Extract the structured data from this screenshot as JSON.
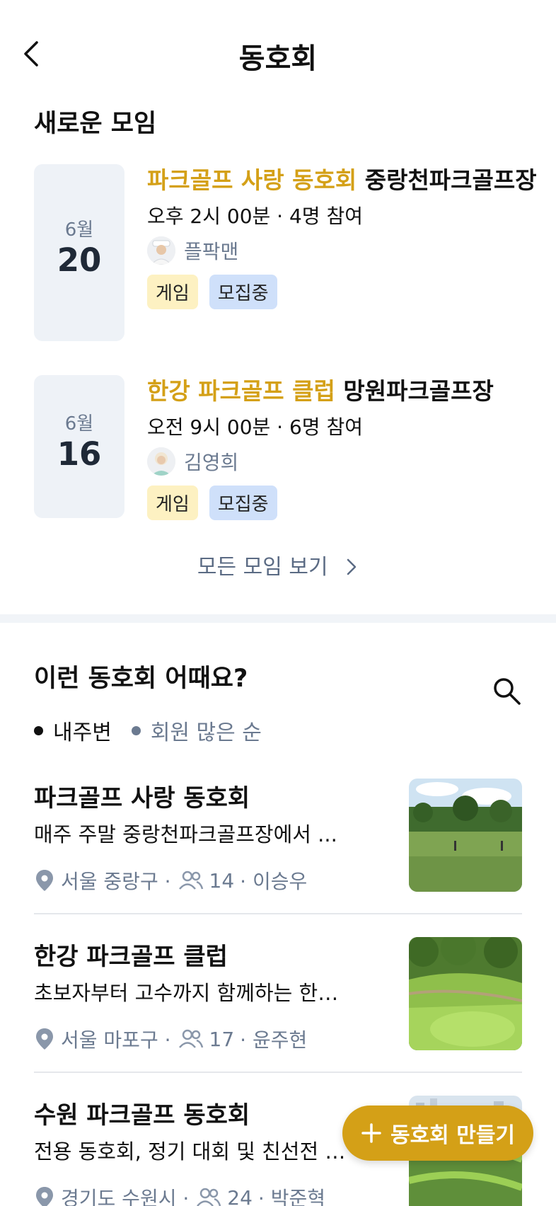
{
  "header": {
    "title": "동호회",
    "back_icon": "chevron-left-icon"
  },
  "new_meetings": {
    "title": "새로운 모임",
    "items": [
      {
        "month": "6월",
        "day": "20",
        "club": "파크골프 사랑 동호회",
        "place": "중랑천파크골프장",
        "time": "오후 2시 00분 · 4명 참여",
        "host": "플팍맨",
        "tags": [
          "게임",
          "모집중"
        ]
      },
      {
        "month": "6월",
        "day": "16",
        "club": "한강 파크골프 클럽",
        "place": "망원파크골프장",
        "time": "오전 9시 00분 · 6명 참여",
        "host": "김영희",
        "tags": [
          "게임",
          "모집중"
        ]
      }
    ],
    "see_all": "모든 모임 보기"
  },
  "recommend": {
    "title": "이런 동호회 어때요?",
    "search_icon": "search-icon",
    "filters": [
      "내주변",
      "회원 많은 순"
    ],
    "clubs": [
      {
        "name": "파크골프 사랑 동호회",
        "desc": "매주 주말 중랑천파크골프장에서 ...",
        "region": "서울 중랑구 ·",
        "members": "14",
        "leader": "· 이승우"
      },
      {
        "name": "한강 파크골프 클럽",
        "desc": "초보자부터 고수까지 함께하는 한강 ...",
        "region": "서울 마포구 ·",
        "members": "17",
        "leader": "· 윤주현"
      },
      {
        "name": "수원 파크골프 동호회",
        "desc": "전용 동호회, 정기 대회 및 친선전 운영",
        "region": "경기도 수원시 ·",
        "members": "24",
        "leader": "· 박준혁"
      }
    ]
  },
  "fab": {
    "label": "동호회 만들기",
    "icon": "plus-icon"
  },
  "colors": {
    "accent": "#d4a017",
    "muted": "#6b7a90",
    "tag_game": "#fdf1c2",
    "tag_recruit": "#cfe0fa"
  }
}
